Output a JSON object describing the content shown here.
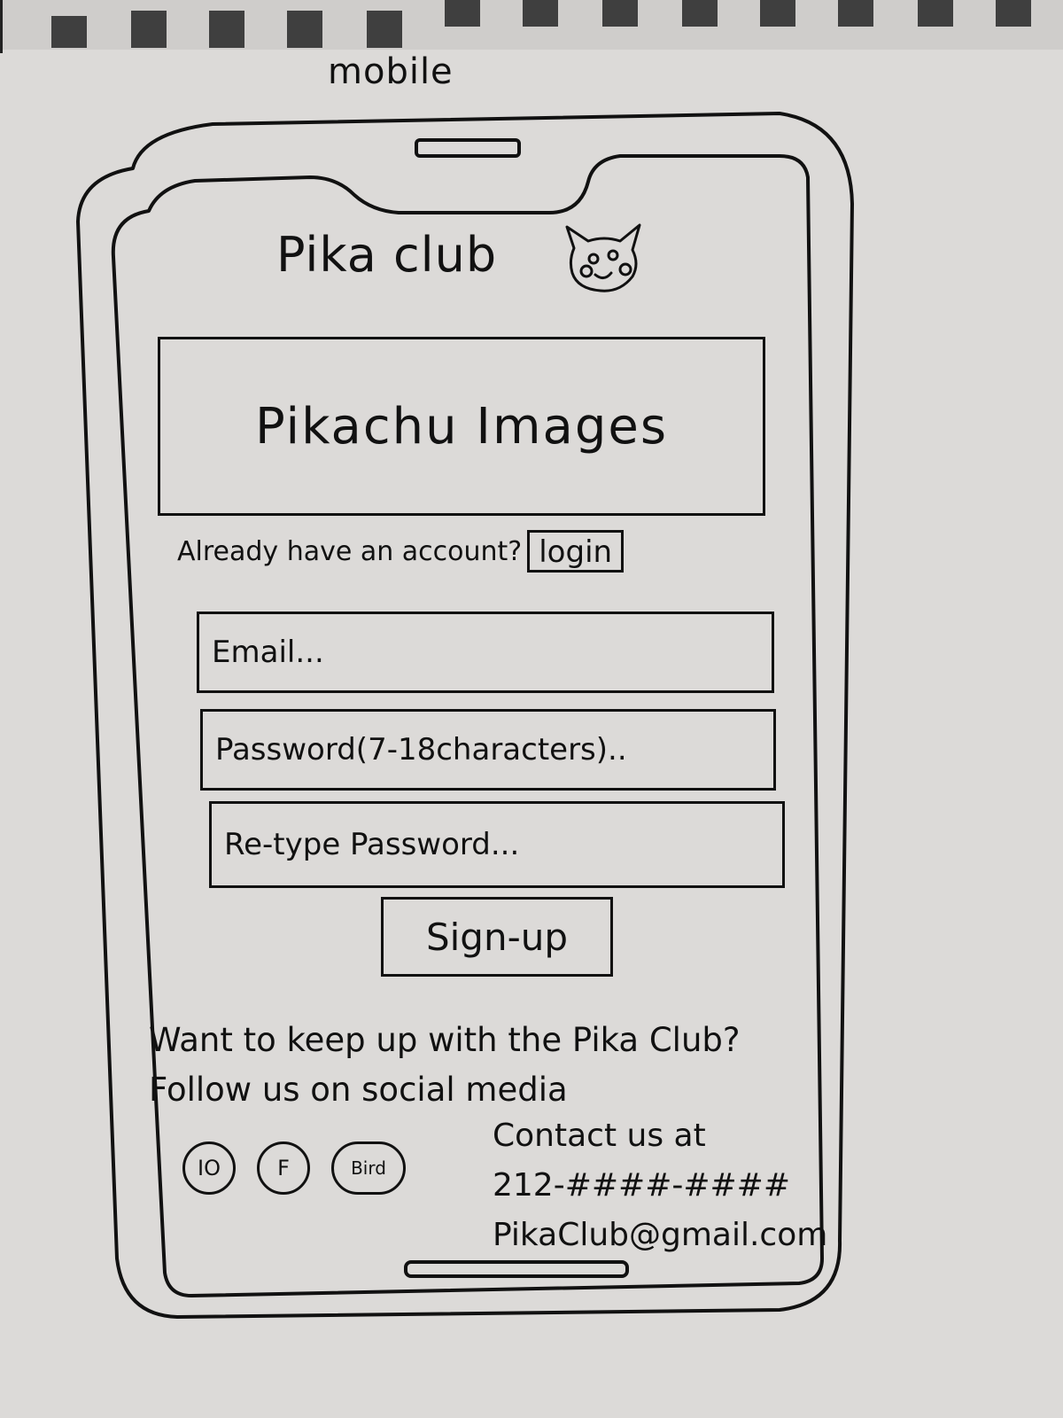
{
  "sketch": {
    "label": "mobile"
  },
  "header": {
    "title": "Pika club",
    "logo_icon": "pikachu-face-icon"
  },
  "hero": {
    "text": "Pikachu Images"
  },
  "account": {
    "prompt": "Already have an account?",
    "login_label": "login"
  },
  "form": {
    "email_placeholder": "Email...",
    "password_placeholder": "Password(7-18characters)..",
    "retype_placeholder": "Re-type Password...",
    "signup_label": "Sign-up"
  },
  "footer": {
    "follow_text": "Want to keep up with the Pika Club? Follow us on social media",
    "social": [
      {
        "icon": "instagram-icon",
        "label": "IO"
      },
      {
        "icon": "facebook-icon",
        "label": "F"
      },
      {
        "icon": "bird-icon",
        "label": "Bird"
      }
    ],
    "contact_heading": "Contact us at",
    "phone": "212-####-####",
    "email": "PikaClub@gmail.com"
  }
}
